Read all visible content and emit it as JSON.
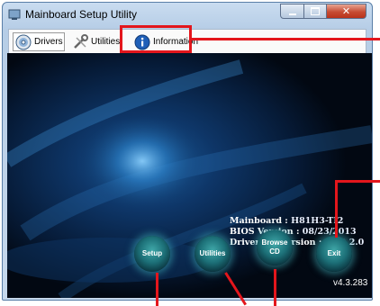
{
  "window": {
    "title": "Mainboard Setup Utility"
  },
  "tabs": [
    {
      "label": "Drivers",
      "icon": "disc-icon",
      "active": true
    },
    {
      "label": "Utilities",
      "icon": "wrench-icon",
      "active": false
    },
    {
      "label": "Information",
      "icon": "info-icon",
      "active": false
    }
  ],
  "info": {
    "mainboard_label": "Mainboard :",
    "mainboard_value": "H81H3-TI2",
    "bios_label": "BIOS Version :",
    "bios_value": "08/23/2013",
    "driver_cd_label": "Driver CD Version :",
    "driver_cd_value": "DVD 2.0"
  },
  "buttons": {
    "setup": "Setup",
    "utilities": "Utilities",
    "browse_cd_line1": "Browse",
    "browse_cd_line2": "CD",
    "exit": "Exit"
  },
  "version": "v4.3.283",
  "colors": {
    "annotation": "#e3161c",
    "title_bar": "#c9dcf0",
    "stage_bg": "#000000",
    "orb": "#1c6f77"
  }
}
